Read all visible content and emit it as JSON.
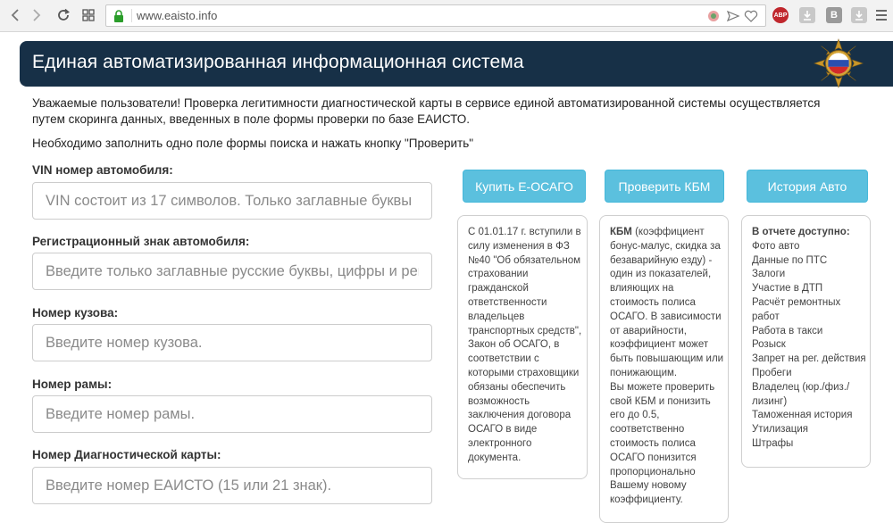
{
  "browser": {
    "url": "www.eaisto.info"
  },
  "header": {
    "title": "Единая автоматизированная информационная система"
  },
  "intro": {
    "paragraph": "Уважаемые пользователи! Проверка легитимности диагностической карты в сервисе единой автоматизированной системы осуществляется путем скоринга данных, введенных в поле формы проверки по базе ЕАИСТО.",
    "instruction": "Необходимо заполнить одно поле формы поиска и нажать кнопку \"Проверить\""
  },
  "form": {
    "fields": [
      {
        "label": "VIN номер автомобиля:",
        "placeholder": "VIN состоит из 17 символов. Только заглавные буквы"
      },
      {
        "label": "Регистрационный знак автомобиля:",
        "placeholder": "Введите только заглавные русские буквы, цифры и регион"
      },
      {
        "label": "Номер кузова:",
        "placeholder": "Введите номер кузова."
      },
      {
        "label": "Номер рамы:",
        "placeholder": "Введите номер рамы."
      },
      {
        "label": "Номер Диагностической карты:",
        "placeholder": "Введите номер ЕАИСТО (15 или 21 знак)."
      }
    ]
  },
  "buttons": {
    "osago": "Купить Е-ОСАГО",
    "kbm": "Проверить КБМ",
    "history": "История Авто"
  },
  "panels": {
    "osago": {
      "lines": [
        "С 01.01.17 г. вступили в",
        "силу изменения в ФЗ",
        "№40 \"Об обязательном",
        "страховании",
        "гражданской",
        "ответственности",
        "владельцев",
        "транспортных средств\",",
        "Закон об ОСАГО, в",
        "соответствии с",
        "которыми страховщики",
        "обязаны обеспечить",
        "возможность",
        "заключения договора",
        "ОСАГО в виде",
        "электронного",
        "документа."
      ]
    },
    "kbm": {
      "first_bold": "КБМ",
      "first_rest": " (коэффициент",
      "lines": [
        "бонус-малус, скидка за",
        "безаварийную езду) -",
        "один из показателей,",
        "влияющих на",
        "стоимость полиса",
        "ОСАГО. В зависимости",
        "от аварийности,",
        "коэффициент может",
        "быть повышающим или",
        "понижающим.",
        "Вы можете проверить",
        "свой КБМ и понизить",
        "его до 0.5,",
        "соответственно",
        "стоимость полиса",
        "ОСАГО понизится",
        "пропорционально",
        "Вашему новому",
        "коэффициенту."
      ]
    },
    "history": {
      "heading": "В отчете доступно:",
      "lines": [
        "Фото авто",
        "Данные по ПТС",
        "Залоги",
        "Участие в ДТП",
        "Расчёт ремонтных",
        "работ",
        "Работа в такси",
        "Розыск",
        "Запрет на рег. действия",
        "Пробеги",
        "Владелец (юр./физ./",
        "лизинг)",
        "Таможенная история",
        "Утилизация",
        "Штрафы"
      ]
    }
  },
  "colors": {
    "banner": "#173047",
    "button": "#5bc0de",
    "lock": "#2a9d2a"
  }
}
